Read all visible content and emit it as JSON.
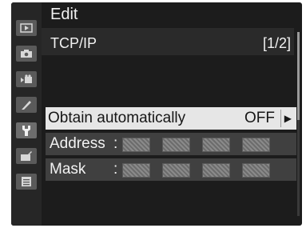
{
  "header": {
    "title": "Edit"
  },
  "subheader": {
    "title": "TCP/IP",
    "page_indicator": "[1/2]"
  },
  "sidebar": {
    "items": [
      {
        "icon": "playback-icon"
      },
      {
        "icon": "camera-icon"
      },
      {
        "icon": "movie-icon"
      },
      {
        "icon": "pencil-icon"
      },
      {
        "icon": "wrench-icon",
        "active": true
      },
      {
        "icon": "retouch-icon"
      },
      {
        "icon": "my-menu-icon"
      }
    ]
  },
  "settings": {
    "obtain": {
      "label": "Obtain automatically",
      "value": "OFF",
      "arrow": "▶"
    },
    "address": {
      "label": "Address",
      "colon": ":"
    },
    "mask": {
      "label": "Mask",
      "colon": ":"
    }
  }
}
